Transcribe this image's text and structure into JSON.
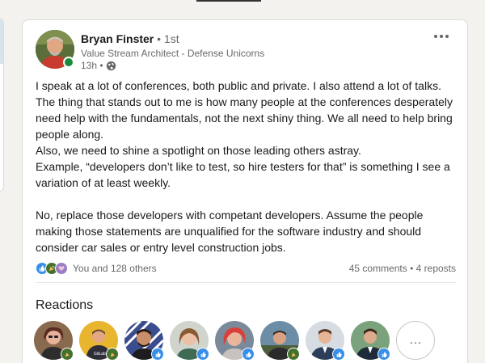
{
  "post": {
    "author": {
      "name": "Bryan Finster",
      "degree": "• 1st",
      "headline": "Value Stream Architect - Defense Unicorns",
      "time": "13h •",
      "visibility_icon": "globe-icon"
    },
    "more_icon": "ellipsis-icon",
    "text": {
      "p1": "I speak at a lot of conferences, both public and private. I also attend a lot of talks. The thing that stands out to me is how many people at the conferences desperately need help with the fundamentals, not the next shiny thing. We all need to help bring people along.",
      "p2": "Also, we need to shine a spotlight on those leading others astray.",
      "p3": "Example, “developers don’t like to test, so hire testers for that” is something I see a variation of at least weekly.",
      "p4": "No, replace those developers with competant developers. Assume the people making those statements are unqualified for the software industry and should consider car sales or entry level construction jobs."
    },
    "social": {
      "reaction_icons": [
        "like-icon",
        "celebrate-icon",
        "support-icon"
      ],
      "reactions_label": "You and 128 others",
      "comments": "45 comments",
      "separator": " • ",
      "reposts": "4 reposts"
    },
    "reactions_section": {
      "title": "Reactions",
      "more_label": "…"
    }
  },
  "colors": {
    "like": "#378fe9",
    "celebrate": "#44712e",
    "support": "#9a7ec5",
    "presence": "#1b8a3c"
  }
}
